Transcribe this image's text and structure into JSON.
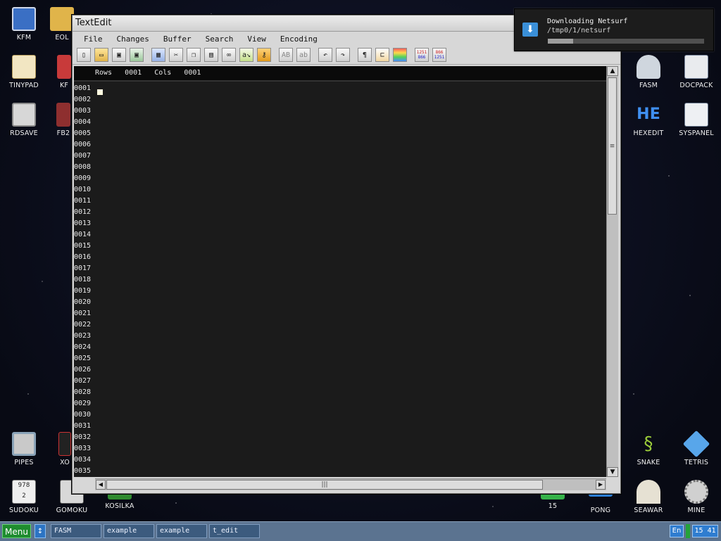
{
  "desktop": {
    "icons_left": [
      {
        "label": "KFM"
      },
      {
        "label": "EOL"
      },
      {
        "label": "TINYPAD"
      },
      {
        "label": "KF"
      },
      {
        "label": "RDSAVE"
      },
      {
        "label": "FB2"
      },
      {
        "label": "PIPES"
      },
      {
        "label": "XO"
      },
      {
        "label": "SUDOKU"
      },
      {
        "label": "GOMOKU"
      },
      {
        "label": "KOSILKA"
      }
    ],
    "icons_right": [
      {
        "label": "FASM"
      },
      {
        "label": "DOCPACK"
      },
      {
        "label": "HEXEDIT"
      },
      {
        "label": "SYSPANEL"
      },
      {
        "label": "SNAKE"
      },
      {
        "label": "TETRIS"
      },
      {
        "label": "15"
      },
      {
        "label": "PONG"
      },
      {
        "label": "SEAWAR"
      },
      {
        "label": "MINE"
      }
    ],
    "hexedit_glyph": "HE",
    "sudoku_digits": [
      "9",
      "7",
      "8",
      "2"
    ]
  },
  "window": {
    "title": "TextEdit",
    "menu": [
      "File",
      "Changes",
      "Buffer",
      "Search",
      "View",
      "Encoding"
    ],
    "toolbar_glyphs": {
      "ab_upper": "AB",
      "ab_lower": "ab",
      "paragraph": "¶",
      "cp1": "1251",
      "cp2": "866"
    },
    "status": {
      "rows_label": "Rows",
      "rows_value": "0001",
      "cols_label": "Cols",
      "cols_value": "0001"
    },
    "line_numbers": [
      "0001",
      "0002",
      "0003",
      "0004",
      "0005",
      "0006",
      "0007",
      "0008",
      "0009",
      "0010",
      "0011",
      "0012",
      "0013",
      "0014",
      "0015",
      "0016",
      "0017",
      "0018",
      "0019",
      "0020",
      "0021",
      "0022",
      "0023",
      "0024",
      "0025",
      "0026",
      "0027",
      "0028",
      "0029",
      "0030",
      "0031",
      "0032",
      "0033",
      "0034",
      "0035"
    ]
  },
  "notification": {
    "title": "Downloading Netsurf",
    "path": "/tmp0/1/netsurf",
    "progress_percent": 16
  },
  "taskbar": {
    "menu_label": "Menu",
    "tasks": [
      "FASM",
      "example",
      "example",
      "t_edit"
    ],
    "language": "En",
    "clock": "15 41"
  }
}
